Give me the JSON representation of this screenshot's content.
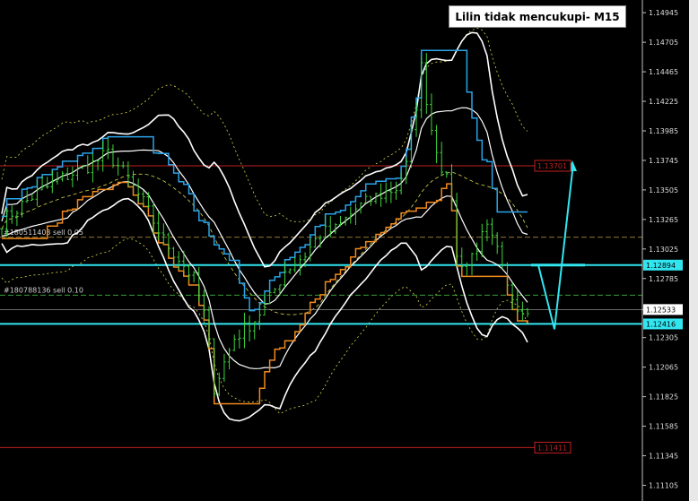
{
  "title": "Lilin tidak mencukupi- M15",
  "colors": {
    "background": "#000000",
    "price": "#3cd43c",
    "bollinger": "#ffffff",
    "envelope": "#d8d84a",
    "channel_blue": "#2aa3e8",
    "channel_orange": "#f08a1e",
    "level_lines": "#c02020",
    "zone_lines": "#32e6f0",
    "arrow": "#32e6f0"
  },
  "orders": [
    {
      "label": "#180511403 sell 0.05",
      "price": 1.1312
    },
    {
      "label": "#180788136 sell 0.10",
      "price": 1.1265
    }
  ],
  "chart_data": {
    "type": "line",
    "y_axis": {
      "ylim": [
        1.1105,
        1.1499
      ],
      "ticks": [
        "1.14945",
        "1.14705",
        "1.14465",
        "1.14225",
        "1.13985",
        "1.13745",
        "1.13505",
        "1.13265",
        "1.13025",
        "1.12785",
        "1.12533",
        "1.12305",
        "1.12065",
        "1.11825",
        "1.11585",
        "1.11345",
        "1.11105"
      ]
    },
    "labeled_levels": [
      {
        "label": "1.13701",
        "value": 1.13701,
        "style": "red-line"
      },
      {
        "label": "1.12894",
        "value": 1.12894,
        "style": "cyan-line"
      },
      {
        "label": "1.12533",
        "value": 1.12533,
        "style": "current-price"
      },
      {
        "label": "1.12416",
        "value": 1.12416,
        "style": "cyan-line"
      },
      {
        "label": "1.11411",
        "value": 1.11411,
        "style": "red-line"
      }
    ],
    "close_path": [
      [
        0,
        1.1325
      ],
      [
        6,
        1.1345
      ],
      [
        12,
        1.136
      ],
      [
        18,
        1.1372
      ],
      [
        21,
        1.138
      ],
      [
        24,
        1.1365
      ],
      [
        28,
        1.134
      ],
      [
        32,
        1.131
      ],
      [
        35,
        1.1295
      ],
      [
        38,
        1.1278
      ],
      [
        40,
        1.125
      ],
      [
        41,
        1.1225
      ],
      [
        42,
        1.119
      ],
      [
        44,
        1.121
      ],
      [
        46,
        1.123
      ],
      [
        50,
        1.1245
      ],
      [
        53,
        1.1262
      ],
      [
        56,
        1.1285
      ],
      [
        60,
        1.1298
      ],
      [
        63,
        1.1315
      ],
      [
        66,
        1.1318
      ],
      [
        70,
        1.1335
      ],
      [
        74,
        1.1345
      ],
      [
        78,
        1.1352
      ],
      [
        80,
        1.137
      ],
      [
        82,
        1.142
      ],
      [
        83,
        1.145
      ],
      [
        85,
        1.14
      ],
      [
        87,
        1.137
      ],
      [
        89,
        1.1345
      ],
      [
        90,
        1.1295
      ],
      [
        92,
        1.129
      ],
      [
        94,
        1.1305
      ],
      [
        96,
        1.1318
      ],
      [
        98,
        1.13
      ],
      [
        100,
        1.127
      ],
      [
        102,
        1.1258
      ],
      [
        104,
        1.1255
      ]
    ]
  }
}
